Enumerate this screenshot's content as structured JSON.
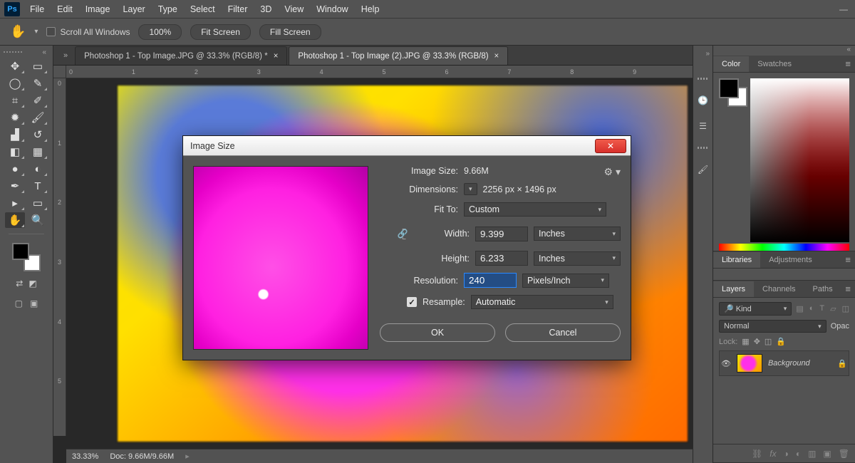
{
  "menubar": {
    "items": [
      "File",
      "Edit",
      "Image",
      "Layer",
      "Type",
      "Select",
      "Filter",
      "3D",
      "View",
      "Window",
      "Help"
    ]
  },
  "options": {
    "scroll_all": "Scroll All Windows",
    "zoom": "100%",
    "fit_screen": "Fit Screen",
    "fill_screen": "Fill Screen"
  },
  "tabs": [
    {
      "label": "Photoshop 1 - Top Image.JPG @ 33.3% (RGB/8) *",
      "active": false
    },
    {
      "label": "Photoshop 1 - Top Image (2).JPG @ 33.3% (RGB/8)",
      "active": true
    }
  ],
  "ruler_h": [
    "0",
    "1",
    "2",
    "3",
    "4",
    "5",
    "6",
    "7",
    "8",
    "9"
  ],
  "ruler_v": [
    "0",
    "1",
    "2",
    "3",
    "4",
    "5"
  ],
  "status": {
    "zoom": "33.33%",
    "doc": "Doc: 9.66M/9.66M"
  },
  "panels": {
    "color_tab": "Color",
    "swatches_tab": "Swatches",
    "libraries_tab": "Libraries",
    "adjustments_tab": "Adjustments",
    "layers_tab": "Layers",
    "channels_tab": "Channels",
    "paths_tab": "Paths",
    "kind": "Kind",
    "blend": "Normal",
    "opacity": "Opac",
    "lock": "Lock:",
    "layer_name": "Background"
  },
  "dialog": {
    "title": "Image Size",
    "image_size_label": "Image Size:",
    "image_size_value": "9.66M",
    "dimensions_label": "Dimensions:",
    "dimensions_value": "2256 px  ×  1496 px",
    "fit_to_label": "Fit To:",
    "fit_to_value": "Custom",
    "width_label": "Width:",
    "width_value": "9.399",
    "width_unit": "Inches",
    "height_label": "Height:",
    "height_value": "6.233",
    "height_unit": "Inches",
    "resolution_label": "Resolution:",
    "resolution_value": "240",
    "resolution_unit": "Pixels/Inch",
    "resample_label": "Resample:",
    "resample_value": "Automatic",
    "ok": "OK",
    "cancel": "Cancel"
  }
}
